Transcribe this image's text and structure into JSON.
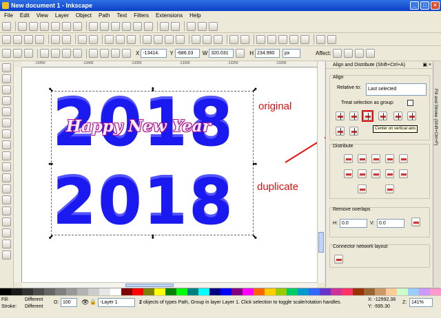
{
  "window": {
    "title": "New document 1 - Inkscape",
    "buttons": [
      "_",
      "□",
      "×"
    ]
  },
  "menu": [
    "File",
    "Edit",
    "View",
    "Layer",
    "Object",
    "Path",
    "Text",
    "Filters",
    "Extensions",
    "Help"
  ],
  "selection_toolbar": {
    "x_label": "X",
    "x_value": "-13414.",
    "y_label": "Y",
    "y_value": "-686.03",
    "w_label": "W",
    "w_value": "320.031",
    "h_label": "H",
    "h_value": "234.990",
    "unit": "px",
    "affect_label": "Affect:"
  },
  "ruler": {
    "ticks": [
      "-13450",
      "-13400",
      "-13350",
      "-13300",
      "-13250",
      "-13200"
    ]
  },
  "canvas": {
    "year_top": "2018",
    "year_bottom": "2018",
    "greeting": "Happy New Year",
    "annotation_original": "original",
    "annotation_duplicate": "duplicate"
  },
  "panel": {
    "title": "Align and Distribute (Shift+Ctrl+A)",
    "align_title": "Align",
    "relative_label": "Relative to:",
    "relative_value": "Last selected",
    "treat_group": "Treat selection as group:",
    "tooltip": "Center on vertical axis",
    "distribute_title": "Distribute",
    "remove_overlaps_title": "Remove overlaps",
    "h_label": "H:",
    "h_value": "0.0",
    "v_label": "V:",
    "v_value": "0.0",
    "connector_title": "Connector network layout"
  },
  "side_tab": "Fill and Stroke (Shift+Ctrl+F)",
  "palette": [
    "#000000",
    "#1a1a1a",
    "#333333",
    "#4d4d4d",
    "#666666",
    "#808080",
    "#999999",
    "#b3b3b3",
    "#cccccc",
    "#e6e6e6",
    "#ffffff",
    "#800000",
    "#ff0000",
    "#808000",
    "#ffff00",
    "#008000",
    "#00ff00",
    "#008080",
    "#00ffff",
    "#000080",
    "#0000ff",
    "#800080",
    "#ff00ff",
    "#ff6600",
    "#ffcc00",
    "#99cc00",
    "#00cc66",
    "#0099cc",
    "#3366ff",
    "#6633cc",
    "#cc3399",
    "#ff3366",
    "#993300",
    "#996633",
    "#cc9966",
    "#ffcc99",
    "#ccffcc",
    "#99ccff",
    "#cc99ff",
    "#ff99cc"
  ],
  "status": {
    "fill_label": "Fill:",
    "fill_value": "Different",
    "stroke_label": "Stroke:",
    "stroke_value": "Different",
    "opacity_label": "O:",
    "opacity_value": "100",
    "layer_value": "-Layer 1",
    "message_count": "2",
    "message_text": "objects of types Path, Group in layer Layer 1. Click selection to toggle scale/rotation handles.",
    "x_coord": "X: -12992.38",
    "y_coord": "Y:   -595.30",
    "zoom_label": "Z:",
    "zoom_value": "141%"
  }
}
